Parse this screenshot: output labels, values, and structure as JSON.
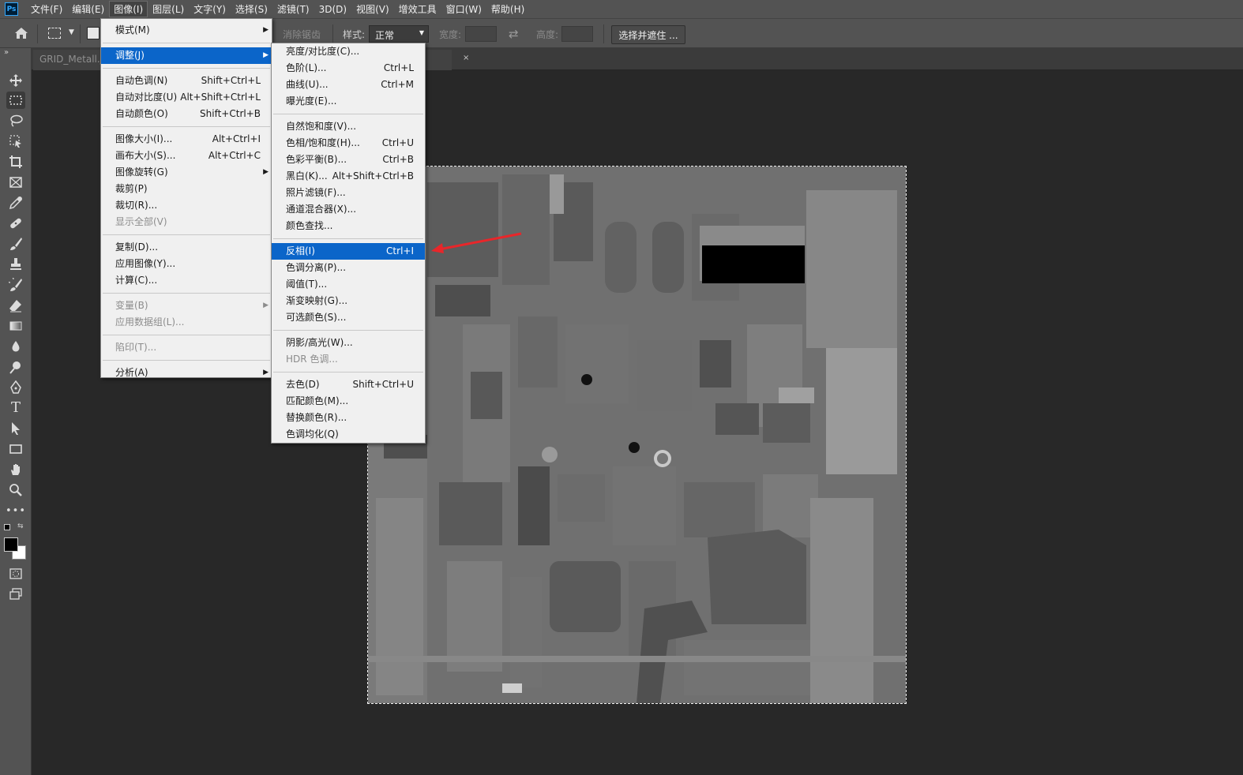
{
  "menubar": {
    "logo": "Ps",
    "items": [
      "文件(F)",
      "编辑(E)",
      "图像(I)",
      "图层(L)",
      "文字(Y)",
      "选择(S)",
      "滤镜(T)",
      "3D(D)",
      "视图(V)",
      "增效工具",
      "窗口(W)",
      "帮助(H)"
    ]
  },
  "options": {
    "antialias_label": "消除锯齿",
    "style_label": "样式:",
    "style_value": "正常",
    "width_label": "宽度:",
    "height_label": "高度:",
    "select_mask_button": "选择并遮住 ..."
  },
  "document": {
    "tab_title": "GRID_Metall.jpg",
    "close_symbol": "×"
  },
  "image_menu": {
    "items": [
      {
        "label": "模式(M)",
        "shortcut": "",
        "submenu": true,
        "disabled": false,
        "highlighted": false
      },
      {
        "label": "调整(J)",
        "shortcut": "",
        "submenu": true,
        "disabled": false,
        "highlighted": true
      },
      {
        "label": "自动色调(N)",
        "shortcut": "Shift+Ctrl+L"
      },
      {
        "label": "自动对比度(U)",
        "shortcut": "Alt+Shift+Ctrl+L"
      },
      {
        "label": "自动颜色(O)",
        "shortcut": "Shift+Ctrl+B"
      },
      {
        "label": "图像大小(I)...",
        "shortcut": "Alt+Ctrl+I"
      },
      {
        "label": "画布大小(S)...",
        "shortcut": "Alt+Ctrl+C"
      },
      {
        "label": "图像旋转(G)",
        "shortcut": "",
        "submenu": true
      },
      {
        "label": "裁剪(P)",
        "shortcut": ""
      },
      {
        "label": "裁切(R)...",
        "shortcut": ""
      },
      {
        "label": "显示全部(V)",
        "shortcut": "",
        "disabled": true
      },
      {
        "label": "复制(D)...",
        "shortcut": ""
      },
      {
        "label": "应用图像(Y)...",
        "shortcut": ""
      },
      {
        "label": "计算(C)...",
        "shortcut": ""
      },
      {
        "label": "变量(B)",
        "shortcut": "",
        "submenu": true,
        "disabled": true
      },
      {
        "label": "应用数据组(L)...",
        "shortcut": "",
        "disabled": true
      },
      {
        "label": "陷印(T)...",
        "shortcut": "",
        "disabled": true
      },
      {
        "label": "分析(A)",
        "shortcut": "",
        "submenu": true
      }
    ]
  },
  "adjust_menu": {
    "items": [
      {
        "label": "亮度/对比度(C)...",
        "shortcut": ""
      },
      {
        "label": "色阶(L)...",
        "shortcut": "Ctrl+L"
      },
      {
        "label": "曲线(U)...",
        "shortcut": "Ctrl+M"
      },
      {
        "label": "曝光度(E)...",
        "shortcut": ""
      },
      {
        "label": "自然饱和度(V)...",
        "shortcut": ""
      },
      {
        "label": "色相/饱和度(H)...",
        "shortcut": "Ctrl+U"
      },
      {
        "label": "色彩平衡(B)...",
        "shortcut": "Ctrl+B"
      },
      {
        "label": "黑白(K)...",
        "shortcut": "Alt+Shift+Ctrl+B"
      },
      {
        "label": "照片滤镜(F)...",
        "shortcut": ""
      },
      {
        "label": "通道混合器(X)...",
        "shortcut": ""
      },
      {
        "label": "颜色查找...",
        "shortcut": ""
      },
      {
        "label": "反相(I)",
        "shortcut": "Ctrl+I",
        "highlighted": true
      },
      {
        "label": "色调分离(P)...",
        "shortcut": ""
      },
      {
        "label": "阈值(T)...",
        "shortcut": ""
      },
      {
        "label": "渐变映射(G)...",
        "shortcut": ""
      },
      {
        "label": "可选颜色(S)...",
        "shortcut": ""
      },
      {
        "label": "阴影/高光(W)...",
        "shortcut": ""
      },
      {
        "label": "HDR 色调...",
        "shortcut": "",
        "disabled": true
      },
      {
        "label": "去色(D)",
        "shortcut": "Shift+Ctrl+U"
      },
      {
        "label": "匹配颜色(M)...",
        "shortcut": ""
      },
      {
        "label": "替换颜色(R)...",
        "shortcut": ""
      },
      {
        "label": "色调均化(Q)",
        "shortcut": ""
      }
    ]
  },
  "tools": [
    "move-tool",
    "rectangular-marquee-tool",
    "lasso-tool",
    "object-selection-tool",
    "crop-tool",
    "frame-tool",
    "eyedropper-tool",
    "healing-brush-tool",
    "brush-tool",
    "clone-stamp-tool",
    "history-brush-tool",
    "eraser-tool",
    "gradient-tool",
    "blur-tool",
    "dodge-tool",
    "pen-tool",
    "type-tool",
    "path-selection-tool",
    "rectangle-tool",
    "hand-tool",
    "zoom-tool",
    "more-tools"
  ],
  "colors": {
    "ui_bg": "#535353",
    "canvas_bg": "#282828",
    "menu_bg": "#f0f0f0",
    "highlight": "#0b65c9",
    "annotation_arrow": "#e8262a"
  }
}
